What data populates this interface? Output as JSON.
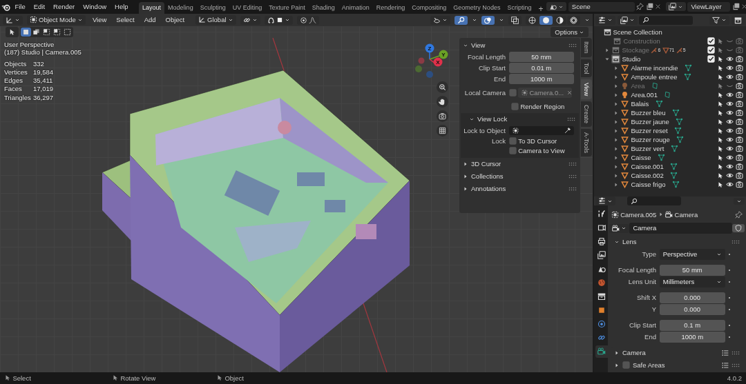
{
  "app_menu": [
    "File",
    "Edit",
    "Render",
    "Window",
    "Help"
  ],
  "workspaces": [
    {
      "label": "Layout",
      "selected": true
    },
    {
      "label": "Modeling",
      "selected": false
    },
    {
      "label": "Sculpting",
      "selected": false
    },
    {
      "label": "UV Editing",
      "selected": false
    },
    {
      "label": "Texture Paint",
      "selected": false
    },
    {
      "label": "Shading",
      "selected": false
    },
    {
      "label": "Animation",
      "selected": false
    },
    {
      "label": "Rendering",
      "selected": false
    },
    {
      "label": "Compositing",
      "selected": false
    },
    {
      "label": "Geometry Nodes",
      "selected": false
    },
    {
      "label": "Scripting",
      "selected": false
    }
  ],
  "add_workspace": "+",
  "scene": {
    "name": "Scene"
  },
  "view_layer": {
    "name": "ViewLayer"
  },
  "viewport": {
    "mode": "Object Mode",
    "menus": [
      "View",
      "Select",
      "Add",
      "Object"
    ],
    "orientation": "Global",
    "options_label": "Options",
    "select_modes": [
      {
        "selected": true
      },
      {
        "selected": false
      },
      {
        "selected": false
      },
      {
        "selected": false
      },
      {
        "selected": false
      }
    ],
    "gizmos_on": true,
    "overlays_on": true,
    "xray_on": false,
    "shading_modes": [
      {
        "kind": "wireframe",
        "selected": false
      },
      {
        "kind": "solid",
        "selected": true
      },
      {
        "kind": "material",
        "selected": false
      },
      {
        "kind": "rendered",
        "selected": false
      }
    ],
    "view_name": "User Perspective",
    "context": "(187) Studio | Camera.005",
    "stats": [
      {
        "label": "Objects",
        "value": "332"
      },
      {
        "label": "Vertices",
        "value": "19,584"
      },
      {
        "label": "Edges",
        "value": "35,411"
      },
      {
        "label": "Faces",
        "value": "17,019"
      },
      {
        "label": "Triangles",
        "value": "36,297"
      }
    ],
    "gizmo_axes": [
      {
        "label": "Z",
        "color": "#2f78e0"
      },
      {
        "label": "Y",
        "color": "#6aa125"
      },
      {
        "label": "X",
        "color": "#e0304a"
      }
    ]
  },
  "sidebar": {
    "tabs": [
      {
        "label": "Item",
        "selected": false
      },
      {
        "label": "Tool",
        "selected": false
      },
      {
        "label": "View",
        "selected": true
      },
      {
        "label": "Create",
        "selected": false
      },
      {
        "label": "A-Tools",
        "selected": false
      }
    ],
    "view_panel": {
      "title": "View",
      "expanded": true,
      "rows": [
        {
          "label": "Focal Length",
          "value": "50 mm"
        },
        {
          "label": "Clip Start",
          "value": "0.01 m"
        },
        {
          "label": "End",
          "value": "1000 m"
        }
      ],
      "local_camera": {
        "label": "Local Camera",
        "checked": false,
        "value": "Camera.0..."
      },
      "render_region": {
        "label": "Render Region",
        "checked": false
      }
    },
    "view_lock": {
      "title": "View Lock",
      "expanded": true,
      "object_label": "Lock to Object",
      "lock_label": "Lock",
      "options": [
        {
          "label": "To 3D Cursor",
          "checked": false
        },
        {
          "label": "Camera to View",
          "checked": false
        }
      ]
    },
    "panels": [
      {
        "title": "3D Cursor",
        "expanded": false
      },
      {
        "title": "Collections",
        "expanded": false
      },
      {
        "title": "Annotations",
        "expanded": false
      }
    ]
  },
  "outliner": {
    "root": "Scene Collection",
    "items": [
      {
        "name": "Construction",
        "kind": "collection",
        "checked": true,
        "active": false,
        "visible": false,
        "renderable": false
      },
      {
        "name": "Stockage",
        "kind": "collection",
        "expanded": false,
        "checked": true,
        "active": false,
        "visible": false,
        "renderable": false,
        "counts": [
          "6",
          "71",
          "5"
        ]
      },
      {
        "name": "Studio",
        "kind": "collection",
        "expanded": true,
        "checked": true,
        "active": true,
        "visible": true,
        "renderable": true,
        "children": [
          {
            "name": "Alarme incendie",
            "kind": "mesh",
            "expanded": false,
            "visible": true
          },
          {
            "name": "Ampoule entree",
            "kind": "mesh",
            "expanded": false,
            "visible": true
          },
          {
            "name": "Area",
            "kind": "light",
            "expanded": false,
            "visible": false
          },
          {
            "name": "Area.001",
            "kind": "light",
            "expanded": false,
            "visible": true
          },
          {
            "name": "Balais",
            "kind": "mesh",
            "expanded": false,
            "visible": true
          },
          {
            "name": "Buzzer bleu",
            "kind": "mesh",
            "expanded": false,
            "visible": true
          },
          {
            "name": "Buzzer jaune",
            "kind": "mesh",
            "expanded": false,
            "visible": true
          },
          {
            "name": "Buzzer reset",
            "kind": "mesh",
            "expanded": false,
            "visible": true
          },
          {
            "name": "Buzzer rouge",
            "kind": "mesh",
            "expanded": false,
            "visible": true
          },
          {
            "name": "Buzzer vert",
            "kind": "mesh",
            "expanded": false,
            "visible": true
          },
          {
            "name": "Caisse",
            "kind": "mesh",
            "expanded": false,
            "visible": true
          },
          {
            "name": "Caisse.001",
            "kind": "mesh",
            "expanded": false,
            "visible": true
          },
          {
            "name": "Caisse.002",
            "kind": "mesh",
            "expanded": false,
            "visible": true
          },
          {
            "name": "Caisse frigo",
            "kind": "mesh",
            "expanded": false,
            "visible": true
          }
        ]
      }
    ]
  },
  "properties": {
    "tabs": [
      {
        "kind": "tool",
        "selected": false
      },
      {
        "kind": "render",
        "selected": false
      },
      {
        "kind": "output",
        "selected": false
      },
      {
        "kind": "view_layer",
        "selected": false
      },
      {
        "kind": "scene",
        "selected": false
      },
      {
        "kind": "world",
        "selected": false
      },
      {
        "kind": "collection",
        "selected": false
      },
      {
        "kind": "object",
        "selected": false
      },
      {
        "kind": "physics",
        "selected": false
      },
      {
        "kind": "constraints",
        "selected": false
      },
      {
        "kind": "data",
        "selected": true
      }
    ],
    "breadcrumb": [
      "Camera.005",
      "Camera"
    ],
    "datablock": "Camera",
    "lens": {
      "title": "Lens",
      "expanded": true,
      "rows": [
        {
          "label": "Type",
          "value": "Perspective",
          "kind": "dropdown",
          "group_start": false
        },
        {
          "label": "Focal Length",
          "value": "50 mm",
          "kind": "number",
          "group_start": true
        },
        {
          "label": "Lens Unit",
          "value": "Millimeters",
          "kind": "dropdown",
          "group_start": false
        },
        {
          "label": "Shift X",
          "value": "0.000",
          "kind": "number",
          "group_start": true
        },
        {
          "label": "Y",
          "value": "0.000",
          "kind": "number",
          "group_start": false
        },
        {
          "label": "Clip Start",
          "value": "0.1 m",
          "kind": "number",
          "group_start": true
        },
        {
          "label": "End",
          "value": "1000 m",
          "kind": "number",
          "group_start": false
        }
      ]
    },
    "panels": [
      {
        "title": "Camera",
        "expanded": false
      },
      {
        "title": "Safe Areas",
        "expanded": false,
        "enabled": false
      }
    ]
  },
  "status_bar": {
    "hints": [
      "Select",
      "Rotate View",
      "Object"
    ],
    "version": "4.0.2"
  }
}
